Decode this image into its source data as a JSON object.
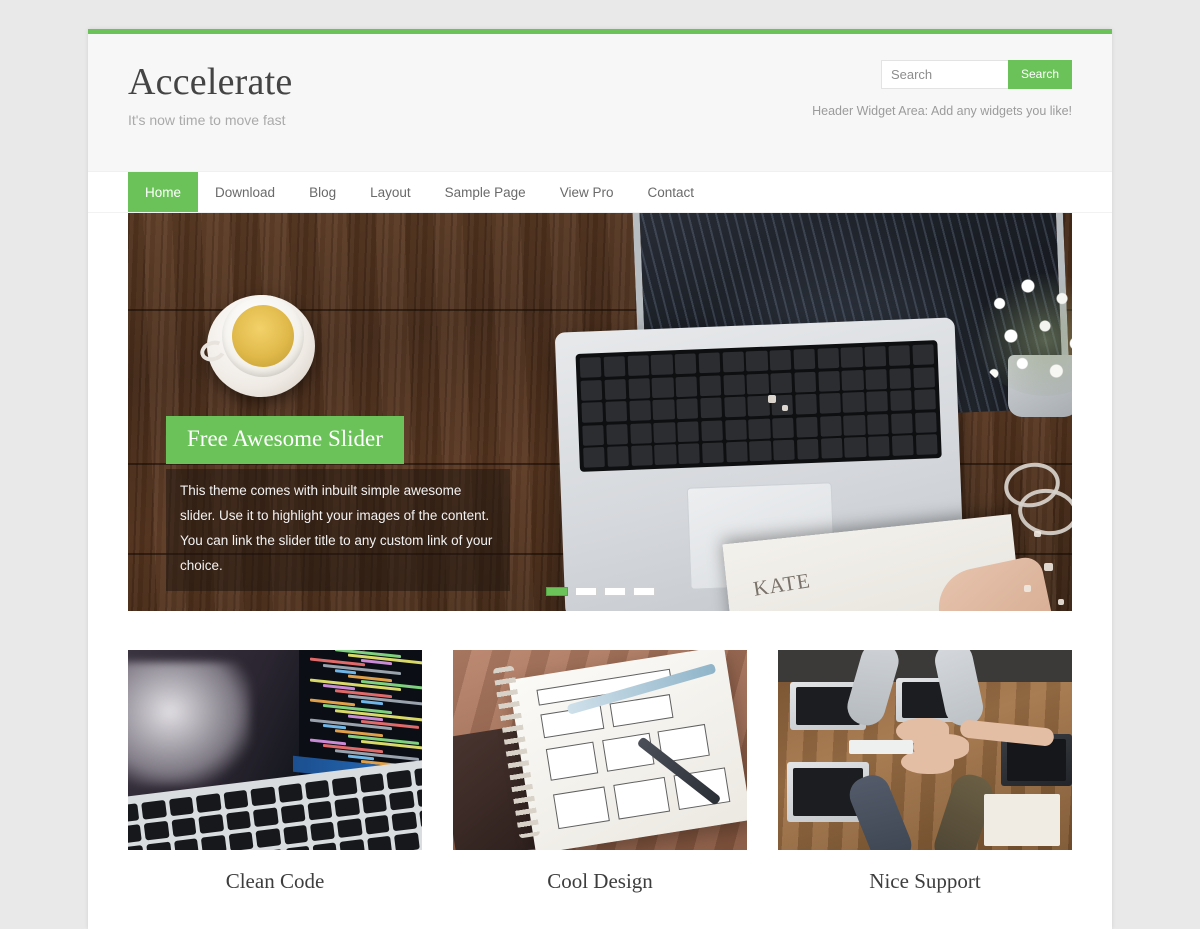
{
  "theme": {
    "accent_color": "#6ac259",
    "header_bg": "#f7f7f7",
    "page_bg": "#e9e9e9",
    "title_color": "#444444"
  },
  "header": {
    "site_title": "Accelerate",
    "site_description": "It's now time to move fast",
    "search": {
      "placeholder": "Search",
      "value": "",
      "button_label": "Search"
    },
    "widget_note": "Header Widget Area: Add any widgets you like!"
  },
  "nav": {
    "items": [
      {
        "label": "Home",
        "active": true
      },
      {
        "label": "Download",
        "active": false
      },
      {
        "label": "Blog",
        "active": false
      },
      {
        "label": "Layout",
        "active": false
      },
      {
        "label": "Sample Page",
        "active": false
      },
      {
        "label": "View Pro",
        "active": false
      },
      {
        "label": "Contact",
        "active": false
      }
    ]
  },
  "slider": {
    "image_alt": "wooden desk with cup of tea, laptop, flowers and open notebook",
    "notebook_text": "KATE",
    "slide_title": "Free Awesome Slider",
    "slide_text": "This theme comes with inbuilt simple awesome slider. Use it to highlight your images of the content. You can link the slider title to any custom link of your choice.",
    "pager": [
      {
        "index": 1,
        "active": true
      },
      {
        "index": 2,
        "active": false
      },
      {
        "index": 3,
        "active": false
      },
      {
        "index": 4,
        "active": false
      }
    ]
  },
  "features": [
    {
      "title": "Clean Code",
      "image_alt": "laptop screen showing colorful source code",
      "text": ""
    },
    {
      "title": "Cool Design",
      "image_alt": "notebook with wireframe sketches, pens and a phone",
      "text": ""
    },
    {
      "title": "Nice Support",
      "image_alt": "team members joining hands over a desk with laptops",
      "text": ""
    }
  ]
}
